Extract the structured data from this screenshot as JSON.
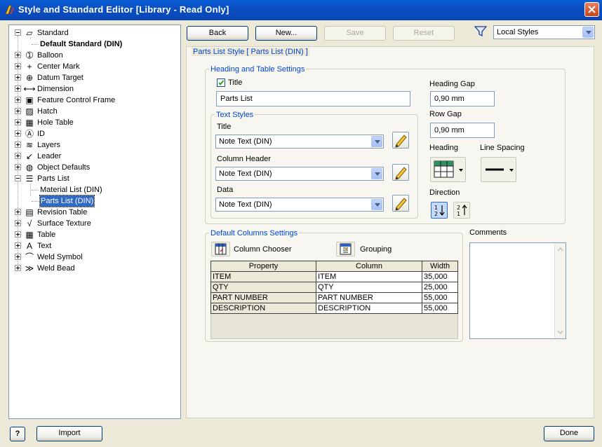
{
  "window": {
    "title": "Style and Standard Editor [Library - Read Only]"
  },
  "tree": {
    "items": [
      {
        "label": "Standard",
        "icon": "standard-icon",
        "expander": "minus",
        "level": 0
      },
      {
        "label": "Default Standard (DIN)",
        "level": 1,
        "bold": true
      },
      {
        "label": "Balloon",
        "icon": "balloon-icon",
        "expander": "plus",
        "level": 0
      },
      {
        "label": "Center Mark",
        "icon": "center-mark-icon",
        "expander": "plus",
        "level": 0
      },
      {
        "label": "Datum Target",
        "icon": "datum-target-icon",
        "expander": "plus",
        "level": 0
      },
      {
        "label": "Dimension",
        "icon": "dimension-icon",
        "expander": "plus",
        "level": 0
      },
      {
        "label": "Feature Control Frame",
        "icon": "feature-control-frame-icon",
        "expander": "plus",
        "level": 0
      },
      {
        "label": "Hatch",
        "icon": "hatch-icon",
        "expander": "plus",
        "level": 0
      },
      {
        "label": "Hole Table",
        "icon": "hole-table-icon",
        "expander": "plus",
        "level": 0
      },
      {
        "label": "ID",
        "icon": "id-icon",
        "expander": "plus",
        "level": 0
      },
      {
        "label": "Layers",
        "icon": "layers-icon",
        "expander": "plus",
        "level": 0
      },
      {
        "label": "Leader",
        "icon": "leader-icon",
        "expander": "plus",
        "level": 0
      },
      {
        "label": "Object Defaults",
        "icon": "object-defaults-icon",
        "expander": "plus",
        "level": 0
      },
      {
        "label": "Parts List",
        "icon": "parts-list-icon",
        "expander": "minus",
        "level": 0
      },
      {
        "label": "Material List (DIN)",
        "level": 1
      },
      {
        "label": "Parts List (DIN)",
        "level": 1,
        "selected": true
      },
      {
        "label": "Revision Table",
        "icon": "revision-table-icon",
        "expander": "plus",
        "level": 0
      },
      {
        "label": "Surface Texture",
        "icon": "surface-texture-icon",
        "expander": "plus",
        "level": 0
      },
      {
        "label": "Table",
        "icon": "table-icon",
        "expander": "plus",
        "level": 0
      },
      {
        "label": "Text",
        "icon": "text-icon",
        "expander": "plus",
        "level": 0
      },
      {
        "label": "Weld Symbol",
        "icon": "weld-symbol-icon",
        "expander": "plus",
        "level": 0
      },
      {
        "label": "Weld Bead",
        "icon": "weld-bead-icon",
        "expander": "plus",
        "level": 0
      }
    ]
  },
  "toolbar": {
    "back": "Back",
    "new": "New...",
    "save": "Save",
    "reset": "Reset",
    "filter_value": "Local Styles"
  },
  "style": {
    "header": "Parts List Style [ Parts List (DIN) ]",
    "heading_group": "Heading and Table Settings",
    "title_checkbox": "Title",
    "title_checked": true,
    "title_value": "Parts List",
    "heading_gap_label": "Heading Gap",
    "heading_gap_value": "0,90 mm",
    "row_gap_label": "Row Gap",
    "row_gap_value": "0,90 mm",
    "heading_label": "Heading",
    "line_spacing_label": "Line Spacing",
    "direction_label": "Direction",
    "text_styles_group": "Text Styles",
    "title_style_label": "Title",
    "title_style_value": "Note Text (DIN)",
    "column_header_label": "Column Header",
    "column_header_value": "Note Text (DIN)",
    "data_label": "Data",
    "data_value": "Note Text (DIN)",
    "default_columns_group": "Default Columns Settings",
    "column_chooser": "Column Chooser",
    "grouping": "Grouping",
    "comments_label": "Comments",
    "comments_value": ""
  },
  "columns_table": {
    "headers": [
      "Property",
      "Column",
      "Width"
    ],
    "rows": [
      [
        "ITEM",
        "ITEM",
        "35,000"
      ],
      [
        "QTY",
        "QTY",
        "25,000"
      ],
      [
        "PART NUMBER",
        "PART NUMBER",
        "55,000"
      ],
      [
        "DESCRIPTION",
        "DESCRIPTION",
        "55,000"
      ]
    ]
  },
  "footer": {
    "help": "?",
    "import": "Import",
    "done": "Done"
  },
  "colors": {
    "titlebar": "#0a50c8",
    "selection": "#316ac5",
    "group_title": "#0046d5",
    "dialog_bg": "#ece9d8"
  }
}
